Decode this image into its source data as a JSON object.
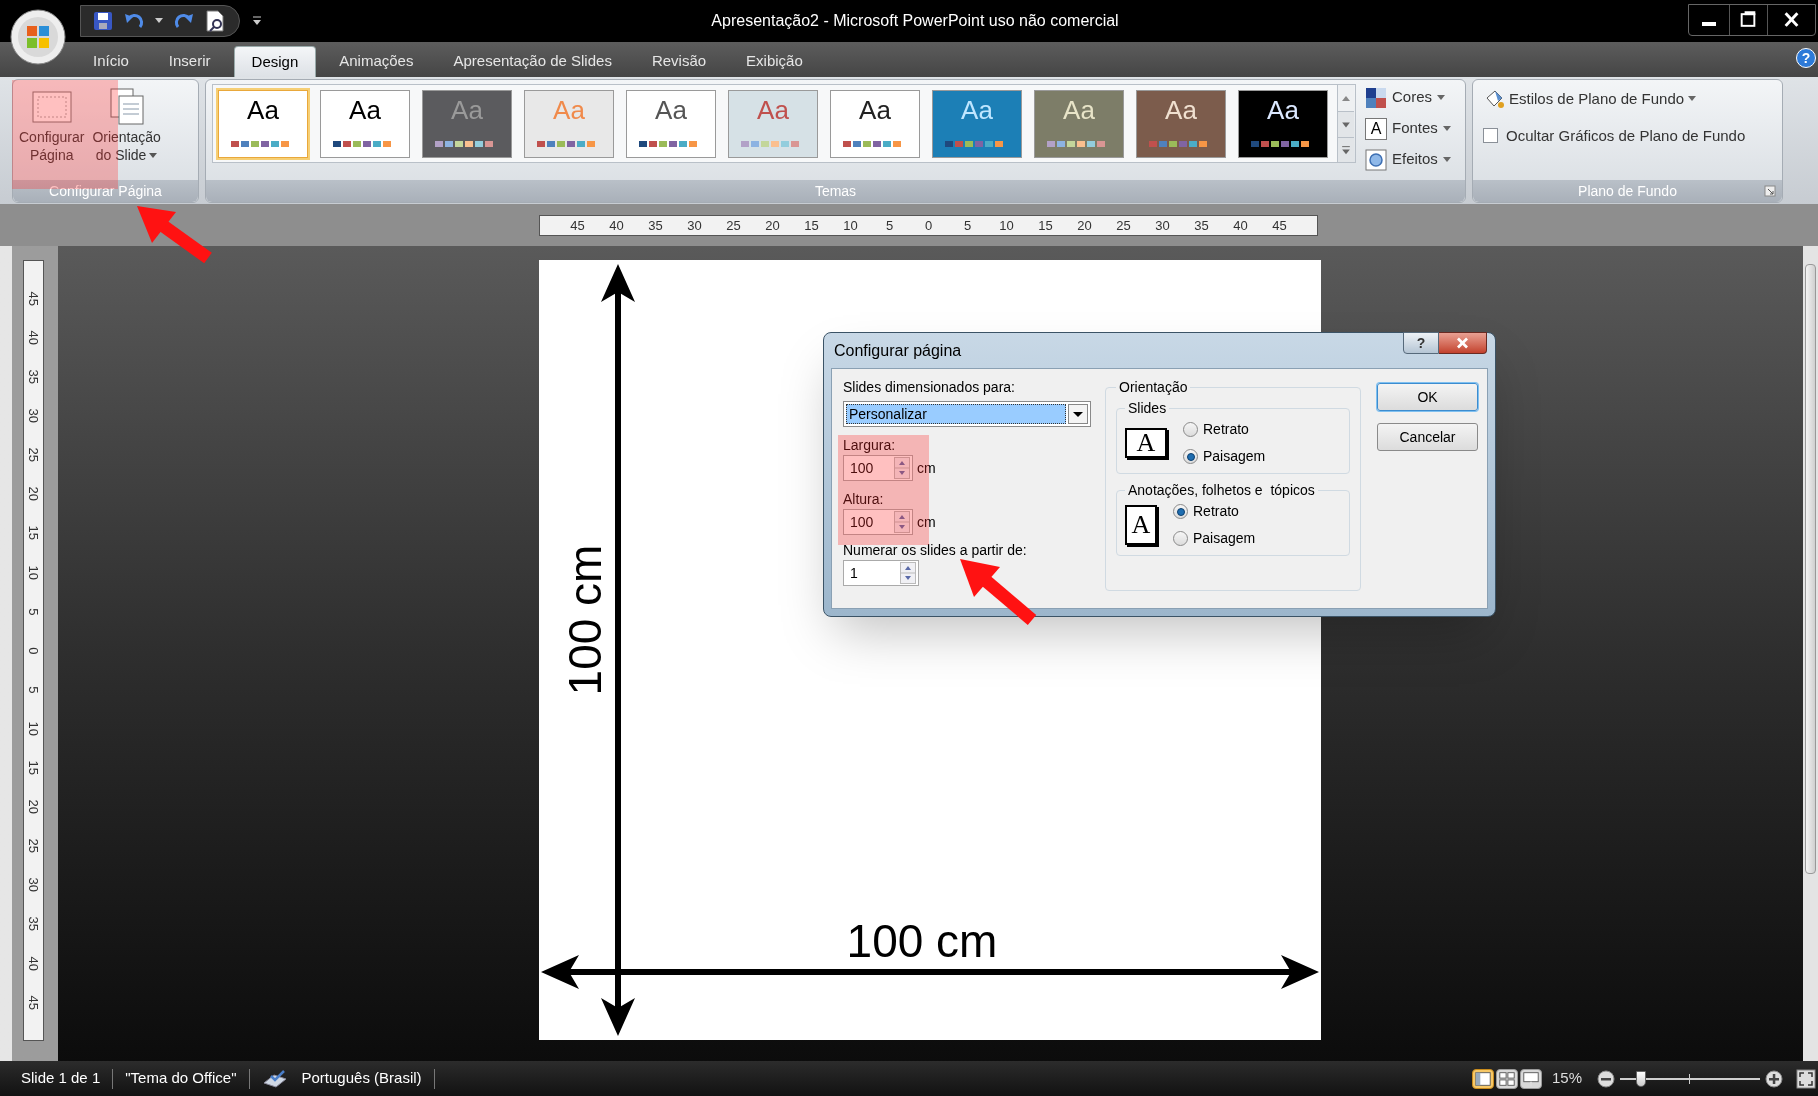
{
  "window": {
    "title": "Apresentação2 - Microsoft PowerPoint uso não comercial",
    "help": "?"
  },
  "tabs": [
    {
      "label": "Início",
      "selected": false
    },
    {
      "label": "Inserir",
      "selected": false
    },
    {
      "label": "Design",
      "selected": true
    },
    {
      "label": "Animações",
      "selected": false
    },
    {
      "label": "Apresentação de Slides",
      "selected": false
    },
    {
      "label": "Revisão",
      "selected": false
    },
    {
      "label": "Exibição",
      "selected": false
    }
  ],
  "ribbon": {
    "page_setup": {
      "label": "Configurar Página",
      "buttons": [
        {
          "label": "Configurar\nPágina",
          "kind": "page_setup",
          "dropdown": false
        },
        {
          "label": "Orientação\ndo Slide",
          "kind": "orientation",
          "dropdown": true
        }
      ]
    },
    "themes": {
      "label": "Temas",
      "items": [
        {
          "sample": {
            "text": "Aa",
            "color": "#000000"
          },
          "color": "#ffffff",
          "selected": true
        },
        {
          "sample": {
            "text": "Aa",
            "color": "#000000"
          },
          "color": "#ffffff",
          "selected": false
        },
        {
          "sample": {
            "text": "Aa",
            "color": "#9a9a9a"
          },
          "color": "#5b5b5e",
          "selected": false
        },
        {
          "sample": {
            "text": "Aa",
            "color": "#f08a4b"
          },
          "color": "#e8e8e8",
          "selected": false
        },
        {
          "sample": {
            "text": "Aa",
            "color": "#555555"
          },
          "color": "#ffffff",
          "selected": false
        },
        {
          "sample": {
            "text": "Aa",
            "color": "#c0504d"
          },
          "color": "#d6e1e6",
          "selected": false
        },
        {
          "sample": {
            "text": "Aa",
            "color": "#222222"
          },
          "color": "#ffffff",
          "selected": false
        },
        {
          "sample": {
            "text": "Aa",
            "color": "#bfe6ff"
          },
          "color": "#1c7fb6",
          "selected": false
        },
        {
          "sample": {
            "text": "Aa",
            "color": "#e8e4c8"
          },
          "color": "#7d7d68",
          "selected": false
        },
        {
          "sample": {
            "text": "Aa",
            "color": "#f0e0d0"
          },
          "color": "#7c5c4c",
          "selected": false
        },
        {
          "sample": {
            "text": "Aa",
            "color": "#dbe8ff"
          },
          "color": "#000000",
          "selected": false
        }
      ],
      "options": [
        {
          "label": "Cores",
          "kind": "colors"
        },
        {
          "label": "Fontes",
          "kind": "fonts",
          "glyph": "A"
        },
        {
          "label": "Efeitos",
          "kind": "effects"
        }
      ]
    },
    "background": {
      "label": "Plano de Fundo",
      "styles_button": "Estilos de Plano de Fundo",
      "hide_graphics": {
        "label": "Ocultar Gráficos de Plano de Fundo",
        "checked": false
      }
    }
  },
  "horizontal_ruler": [
    "45",
    "40",
    "35",
    "30",
    "25",
    "20",
    "15",
    "10",
    "5",
    "0",
    "5",
    "10",
    "15",
    "20",
    "25",
    "30",
    "35",
    "40",
    "45"
  ],
  "vertical_ruler": [
    "45",
    "40",
    "35",
    "30",
    "25",
    "20",
    "15",
    "10",
    "5",
    "0",
    "5",
    "10",
    "15",
    "20",
    "25",
    "30",
    "35",
    "40",
    "45"
  ],
  "slide": {
    "height_label": "100 cm",
    "width_label": "100 cm"
  },
  "dialog": {
    "title": "Configurar página",
    "help": "?",
    "size_label": "Slides dimensionados para:",
    "size_value": "Personalizar",
    "fields": [
      {
        "label": "Largura:",
        "value": "100",
        "unit": "cm"
      },
      {
        "label": "Altura:",
        "value": "100",
        "unit": "cm"
      }
    ],
    "numbering": {
      "label": "Numerar os slides a partir de:",
      "value": "1"
    },
    "orientation": {
      "title": "Orientação",
      "groups": [
        {
          "title": "Slides",
          "kind": "landscape",
          "glyph": "A",
          "options": [
            {
              "label": "Retrato",
              "selected": false
            },
            {
              "label": "Paisagem",
              "selected": true
            }
          ]
        },
        {
          "title": "Anotações, folhetos e  tópicos",
          "kind": "portrait",
          "glyph": "A",
          "options": [
            {
              "label": "Retrato",
              "selected": true
            },
            {
              "label": "Paisagem",
              "selected": false
            }
          ]
        }
      ]
    },
    "buttons": [
      "OK",
      "Cancelar"
    ]
  },
  "status_bar": {
    "slide_info": "Slide 1 de 1",
    "theme": "\"Tema do Office\"",
    "language": "Português (Brasil)",
    "views": [
      {
        "selected": true
      },
      {
        "selected": false
      },
      {
        "selected": false
      }
    ],
    "zoom": "15%",
    "zoom_slider": {
      "level": 0.15
    }
  }
}
